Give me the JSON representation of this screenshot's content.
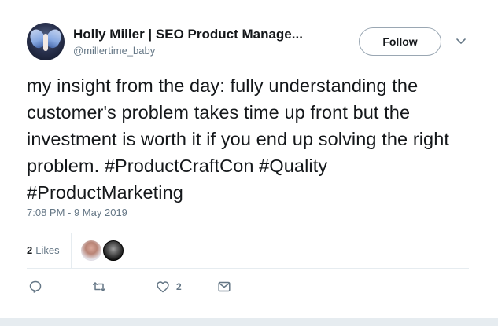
{
  "author": {
    "display_name": "Holly Miller | SEO Product Manage...",
    "handle": "@millertime_baby"
  },
  "follow_label": "Follow",
  "tweet": {
    "text": "my insight from the day: fully understanding the customer's problem takes time up front but the investment is worth it if you end up solving the right problem. #ProductCraftCon #Quality #ProductMarketing",
    "timestamp": "7:08 PM - 9 May 2019"
  },
  "engagement": {
    "likes_count": "2",
    "likes_label": "Likes"
  },
  "actions": {
    "like_count": "2"
  },
  "icons": {
    "reply": "speech-bubble-icon",
    "retweet": "retweet-arrows-icon",
    "like": "heart-icon",
    "dm": "envelope-icon",
    "caret": "chevron-down-icon"
  },
  "colors": {
    "text": "#14171a",
    "secondary": "#657786",
    "border": "#e6ecf0",
    "accent": "#1da1f2"
  }
}
